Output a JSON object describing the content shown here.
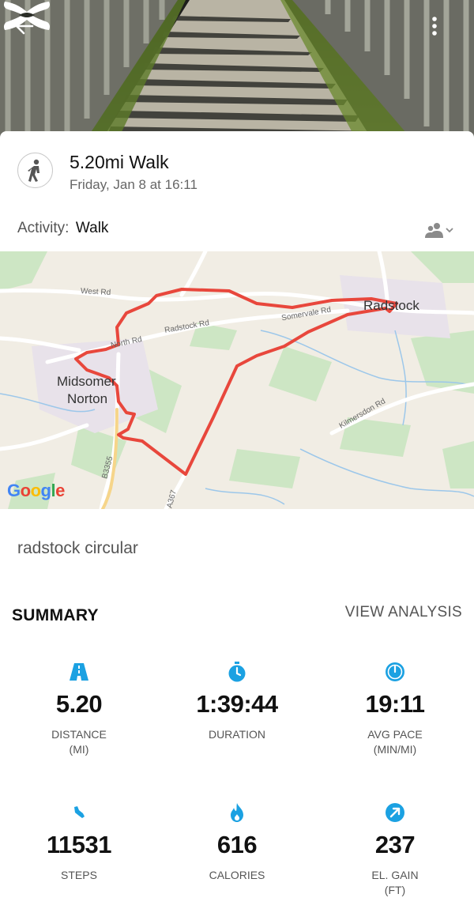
{
  "header": {
    "back_icon": "arrow-left-icon",
    "brand": "under-armour-logo",
    "more_icon": "vertical-dots-icon"
  },
  "activity": {
    "type_icon": "walking-person-icon",
    "title": "5.20mi Walk",
    "date": "Friday, Jan 8 at 16:11",
    "activity_label": "Activity:",
    "activity_value": "Walk",
    "privacy_icon": "people-icon"
  },
  "map": {
    "labels": {
      "west_rd": "West Rd",
      "north_rd": "North Rd",
      "radstock_rd": "Radstock Rd",
      "somervale_rd": "Somervale Rd",
      "radstock": "Radstock",
      "midsomer_norton_1": "Midsomer",
      "midsomer_norton_2": "Norton",
      "kilmersdon_rd": "Kilmersdon Rd",
      "b3355": "B3355",
      "a367": "A367"
    },
    "google": [
      "G",
      "o",
      "o",
      "g",
      "l",
      "e"
    ],
    "route_color": "#e8473c"
  },
  "route_name": "radstock circular",
  "summary": {
    "title": "SUMMARY",
    "view_analysis": "VIEW ANALYSIS",
    "accent": "#1ba1e2",
    "stats": [
      {
        "icon": "road-icon",
        "value": "5.20",
        "label_1": "DISTANCE",
        "label_2": "(MI)"
      },
      {
        "icon": "stopwatch-icon",
        "value": "1:39:44",
        "label_1": "DURATION",
        "label_2": ""
      },
      {
        "icon": "pace-gauge-icon",
        "value": "19:11",
        "label_1": "AVG PACE",
        "label_2": "(MIN/MI)"
      },
      {
        "icon": "shoe-icon",
        "value": "11531",
        "label_1": "STEPS",
        "label_2": ""
      },
      {
        "icon": "flame-icon",
        "value": "616",
        "label_1": "CALORIES",
        "label_2": ""
      },
      {
        "icon": "elevation-arrow-icon",
        "value": "237",
        "label_1": "EL. GAIN",
        "label_2": "(FT)"
      }
    ]
  }
}
